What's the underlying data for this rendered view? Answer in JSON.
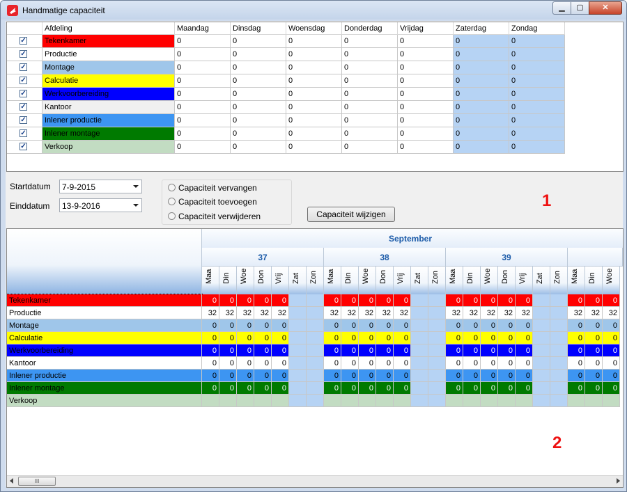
{
  "window": {
    "title": "Handmatige capaciteit",
    "controls": {
      "minimize": "▁",
      "maximize": "▢",
      "close": "✕"
    }
  },
  "colors": {
    "red": "#ff0000",
    "white": "#ffffff",
    "lightblue": "#9fc6ea",
    "yellow": "#ffff00",
    "blue": "#0000ff",
    "offwhite": "#f0f0f0",
    "sky": "#3d95f2",
    "green": "#007a00",
    "pale": "#c2dcc2",
    "weekend": "#b6d3f4",
    "selected": "#6b89b3"
  },
  "top_grid": {
    "columns": [
      "Afdeling",
      "Maandag",
      "Dinsdag",
      "Woensdag",
      "Donderdag",
      "Vrijdag",
      "Zaterdag",
      "Zondag"
    ],
    "rows": [
      {
        "name": "Tekenkamer",
        "color": "#ff0000",
        "checked": true,
        "values": [
          "0",
          "0",
          "0",
          "0",
          "0",
          "0",
          "0"
        ]
      },
      {
        "name": "Productie",
        "color": "#ffffff",
        "checked": true,
        "values": [
          "0",
          "0",
          "0",
          "0",
          "0",
          "0",
          "0"
        ]
      },
      {
        "name": "Montage",
        "color": "#9fc6ea",
        "checked": true,
        "values": [
          "0",
          "0",
          "0",
          "0",
          "0",
          "0",
          "0"
        ]
      },
      {
        "name": "Calculatie",
        "color": "#ffff00",
        "checked": true,
        "values": [
          "0",
          "0",
          "0",
          "0",
          "0",
          "0",
          "0"
        ]
      },
      {
        "name": "Werkvoorbereiding",
        "color": "#0000ff",
        "checked": true,
        "values": [
          "0",
          "0",
          "0",
          "0",
          "0",
          "0",
          "0"
        ]
      },
      {
        "name": "Kantoor",
        "color": "#f0f0f0",
        "checked": true,
        "values": [
          "0",
          "0",
          "0",
          "0",
          "0",
          "0",
          "0"
        ]
      },
      {
        "name": "Inlener productie",
        "color": "#3d95f2",
        "checked": true,
        "values": [
          "0",
          "0",
          "0",
          "0",
          "0",
          "0",
          "0"
        ]
      },
      {
        "name": "Inlener montage",
        "color": "#007a00",
        "checked": true,
        "values": [
          "0",
          "0",
          "0",
          "0",
          "0",
          "0",
          "0"
        ]
      },
      {
        "name": "Verkoop",
        "color": "#c2dcc2",
        "checked": true,
        "values": [
          "0",
          "0",
          "0",
          "0",
          "0",
          "0",
          "0"
        ]
      }
    ]
  },
  "filter": {
    "start_label": "Startdatum",
    "start_value": "7-9-2015",
    "end_label": "Einddatum",
    "end_value": "13-9-2016",
    "options": [
      "Capaciteit vervangen",
      "Capaciteit toevoegen",
      "Capaciteit verwijderen"
    ],
    "apply_label": "Capaciteit wijzigen",
    "marker_1": "1",
    "marker_2": "2"
  },
  "bottom_grid": {
    "month": "September",
    "weeks": [
      "37",
      "38",
      "39"
    ],
    "day_labels": [
      "Maa",
      "Din",
      "Woe",
      "Don",
      "Vrij",
      "Zat",
      "Zon"
    ],
    "rows": [
      {
        "name": "Tekenkamer",
        "color": "#ff0000",
        "values": [
          "0",
          "0",
          "0",
          "0",
          "0",
          "",
          "",
          "0",
          "0",
          "0",
          "0",
          "0",
          "",
          "",
          "0",
          "0",
          "0",
          "0",
          "0",
          "",
          "",
          "0",
          "0",
          "0"
        ]
      },
      {
        "name": "Productie",
        "color": "#ffffff",
        "values": [
          "32",
          "32",
          "32",
          "32",
          "32",
          "",
          "",
          "32",
          "32",
          "32",
          "32",
          "32",
          "",
          "",
          "32",
          "32",
          "32",
          "32",
          "32",
          "",
          "",
          "32",
          "32",
          "32"
        ]
      },
      {
        "name": "Montage",
        "color": "#9fc6ea",
        "values": [
          "0",
          "0",
          "0",
          "0",
          "0",
          "",
          "",
          "0",
          "0",
          "0",
          "0",
          "0",
          "",
          "",
          "0",
          "0",
          "0",
          "0",
          "0",
          "",
          "",
          "0",
          "0",
          "0"
        ]
      },
      {
        "name": "Calculatie",
        "color": "#ffff00",
        "values": [
          "0",
          "0",
          "0",
          "0",
          "0",
          "",
          "",
          "0",
          "0",
          "0",
          "0",
          "0",
          "",
          "",
          "0",
          "0",
          "0",
          "0",
          "0",
          "",
          "",
          "0",
          "0",
          "0"
        ]
      },
      {
        "name": "Werkvoorbereiding",
        "color": "#0000ff",
        "values": [
          "0",
          "0",
          "0",
          "0",
          "0",
          "",
          "",
          "0",
          "0",
          "0",
          "0",
          "0",
          "",
          "",
          "0",
          "0",
          "0",
          "0",
          "0",
          "",
          "",
          "0",
          "0",
          "0"
        ]
      },
      {
        "name": "Kantoor",
        "color": "#ffffff",
        "values": [
          "0",
          "0",
          "0",
          "0",
          "0",
          "",
          "",
          "0",
          "0",
          "0",
          "0",
          "0",
          "",
          "",
          "0",
          "0",
          "0",
          "0",
          "0",
          "",
          "",
          "0",
          "0",
          "0"
        ]
      },
      {
        "name": "Inlener productie",
        "color": "#3d95f2",
        "values": [
          "0",
          "0",
          "0",
          "0",
          "0",
          "",
          "",
          "0",
          "0",
          "0",
          "0",
          "0",
          "",
          "",
          "0",
          "0",
          "0",
          "0",
          "0",
          "",
          "",
          "0",
          "0",
          "0"
        ]
      },
      {
        "name": "Inlener montage",
        "color": "#007a00",
        "values": [
          "0",
          "0",
          "0",
          "0",
          "0",
          "",
          "",
          "0",
          "0",
          "0",
          "0",
          "0",
          "",
          "",
          "0",
          "0",
          "0",
          "0",
          "0",
          "",
          "",
          "0",
          "0",
          "0"
        ]
      },
      {
        "name": "Verkoop",
        "color": "#c2dcc2",
        "values": [
          "",
          "",
          "",
          "",
          "",
          "",
          "",
          "",
          "",
          "",
          "",
          "",
          "",
          "",
          "",
          "",
          "",
          "",
          "",
          "",
          "",
          "",
          "",
          ""
        ]
      }
    ],
    "scroll_grip": "III"
  }
}
